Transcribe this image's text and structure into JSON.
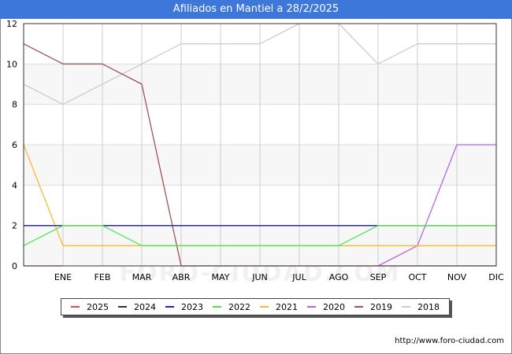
{
  "header": {
    "title": "Afiliados en Mantiel a 28/2/2025",
    "bg_color": "#3d77d9"
  },
  "footer": {
    "url": "http://www.foro-ciudad.com"
  },
  "watermark": {
    "text": "FORO-CIUDAD.COM"
  },
  "chart_data": {
    "type": "line",
    "title": "Afiliados en Mantiel a 28/2/2025",
    "xlabel": "",
    "ylabel": "",
    "categories": [
      "",
      "ENE",
      "FEB",
      "MAR",
      "ABR",
      "MAY",
      "JUN",
      "JUL",
      "AGO",
      "SEP",
      "OCT",
      "NOV",
      "DIC"
    ],
    "yticks": [
      0,
      2,
      4,
      6,
      8,
      10,
      12
    ],
    "ylim": [
      0,
      12
    ],
    "grid": true,
    "legend_position": "bottom",
    "series": [
      {
        "name": "2018",
        "color": "#cccccc",
        "values": [
          9,
          8,
          9,
          10,
          11,
          11,
          11,
          12,
          12,
          10,
          11,
          11,
          11
        ]
      },
      {
        "name": "2019",
        "color": "#a05454",
        "values": [
          11,
          10,
          10,
          9,
          0,
          0,
          0,
          0,
          0,
          0,
          0,
          0,
          0
        ]
      },
      {
        "name": "2020",
        "color": "#b566e8",
        "values": [
          null,
          null,
          null,
          null,
          null,
          null,
          null,
          null,
          null,
          0,
          1,
          6,
          6
        ]
      },
      {
        "name": "2021",
        "color": "#ffb732",
        "values": [
          6,
          1,
          1,
          1,
          1,
          1,
          1,
          1,
          1,
          1,
          1,
          1,
          1
        ]
      },
      {
        "name": "2022",
        "color": "#4ee84e",
        "values": [
          1,
          2,
          2,
          1,
          1,
          1,
          1,
          1,
          1,
          2,
          2,
          2,
          2
        ]
      },
      {
        "name": "2023",
        "color": "#2626b8",
        "values": [
          2,
          2,
          2,
          2,
          2,
          2,
          2,
          2,
          2,
          2,
          2,
          2,
          2
        ]
      },
      {
        "name": "2024",
        "color": "#333333",
        "values": [
          2,
          2,
          2,
          2,
          2,
          2,
          2,
          2,
          2,
          2,
          2,
          2,
          2
        ]
      },
      {
        "name": "2025",
        "color": "#e84b4b",
        "values": [
          0,
          0
        ]
      }
    ],
    "draw_order": [
      "2018",
      "2019",
      "2020",
      "2021",
      "2024",
      "2023",
      "2022",
      "2025"
    ],
    "legend_order": [
      "2025",
      "2024",
      "2023",
      "2022",
      "2021",
      "2020",
      "2019",
      "2018"
    ]
  }
}
